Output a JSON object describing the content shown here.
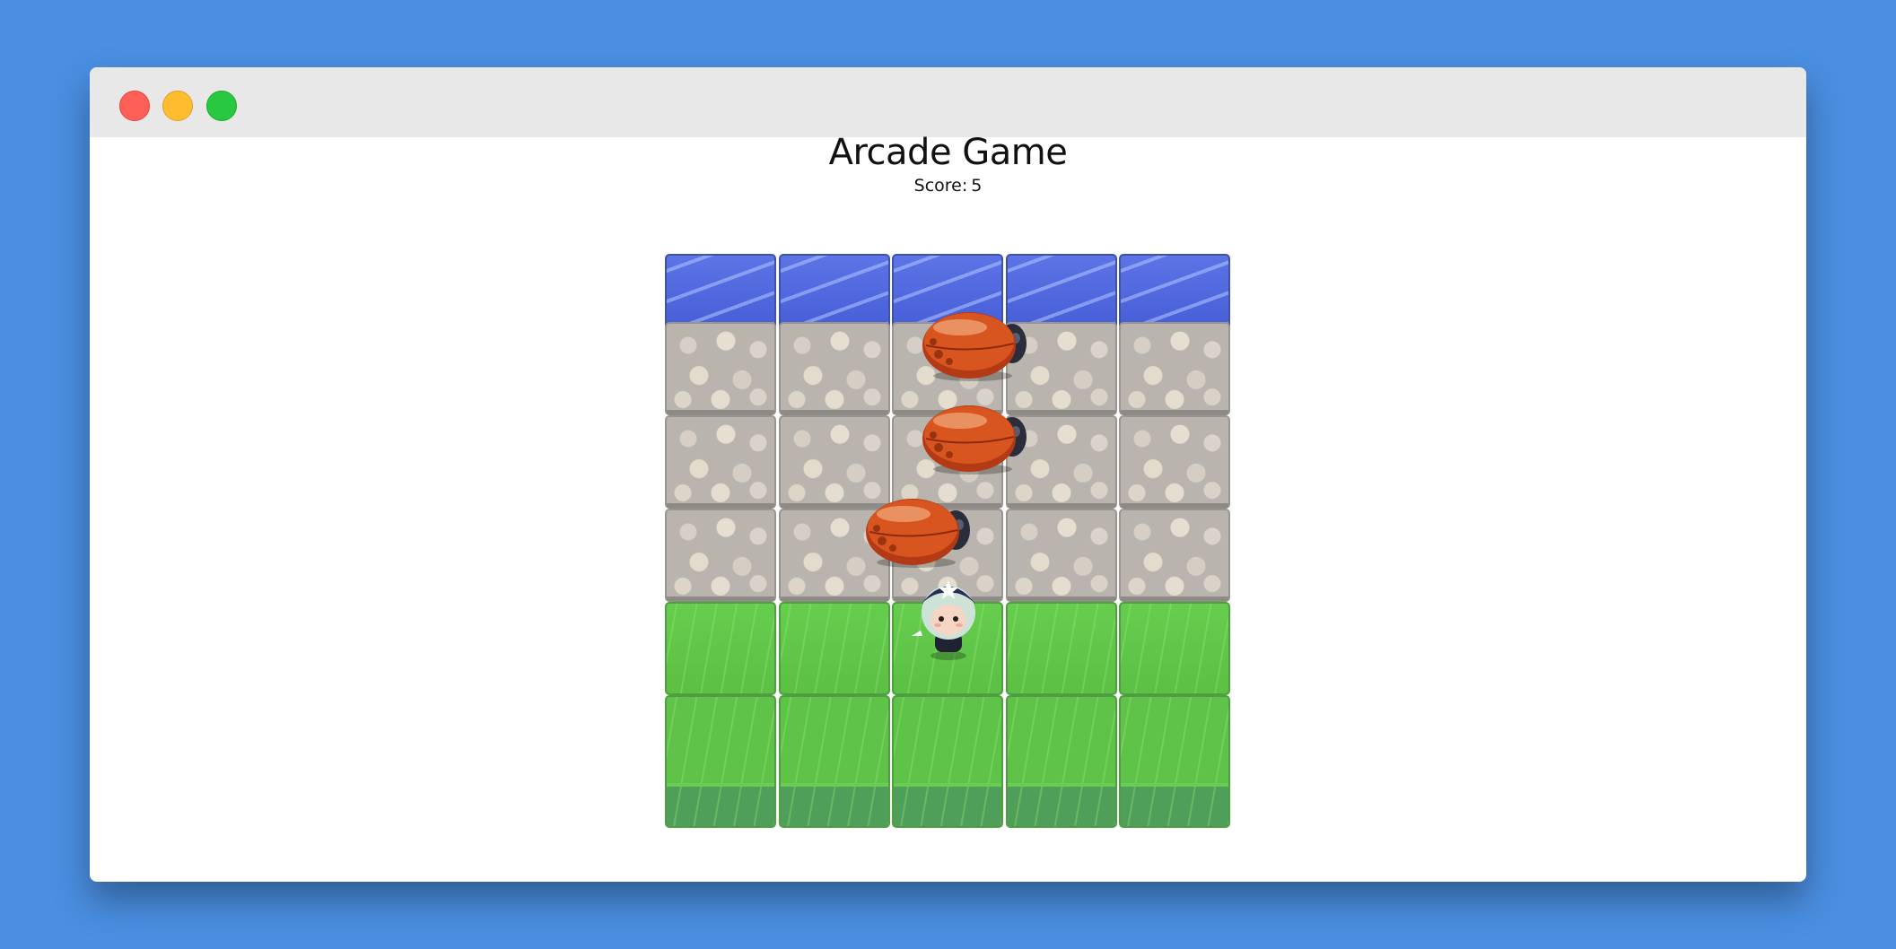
{
  "window": {
    "title": "Arcade Game"
  },
  "hud": {
    "score_label": "Score:",
    "score_value": "5"
  },
  "board": {
    "columns": 5,
    "rows": [
      "water",
      "stone",
      "stone",
      "stone",
      "grass",
      "grass"
    ]
  },
  "entities": {
    "enemies": [
      {
        "name": "enemy-bug",
        "row": 1,
        "col": 2.3
      },
      {
        "name": "enemy-bug",
        "row": 2,
        "col": 2.3
      },
      {
        "name": "enemy-bug",
        "row": 3,
        "col": 1.8
      }
    ],
    "player": {
      "name": "player",
      "row": 4,
      "col": 2
    }
  },
  "colors": {
    "background": "#4a8fe2",
    "titlebar": "#e8e8e8",
    "close": "#fe5f57",
    "minimize": "#febc2e",
    "maximize": "#28c840"
  }
}
